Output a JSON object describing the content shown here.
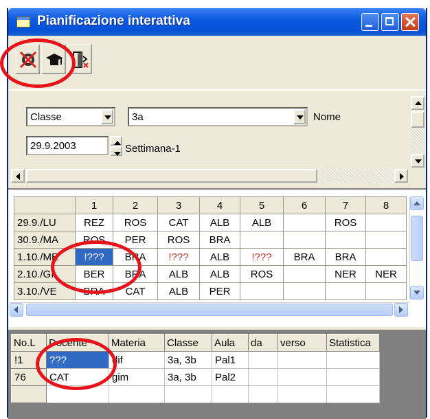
{
  "window": {
    "title": "Pianificazione interattiva"
  },
  "toolbar": {
    "tools": [
      "no-access-icon",
      "graduation-cap-icon",
      "exit-door-icon"
    ]
  },
  "filters": {
    "type_select": "Classe",
    "class_select": "3a",
    "name_label": "Nome",
    "date_value": "29.9.2003",
    "week_label": "Settimana-1"
  },
  "timetable": {
    "columns": [
      "1",
      "2",
      "3",
      "4",
      "5",
      "6",
      "7",
      "8"
    ],
    "rows": [
      {
        "label": "29.9./LU",
        "cells": [
          "REZ",
          "ROS",
          "CAT",
          "ALB",
          "ALB",
          "",
          "ROS",
          ""
        ]
      },
      {
        "label": "30.9./MA",
        "cells": [
          "ROS",
          "PER",
          "ROS",
          "BRA",
          "",
          "",
          "",
          ""
        ]
      },
      {
        "label": "1.10./ME",
        "cells": [
          "!???",
          "BRA",
          "!???",
          "ALB",
          "!???",
          "BRA",
          "BRA",
          ""
        ]
      },
      {
        "label": "2.10./GI",
        "cells": [
          "BER",
          "BRA",
          "ALB",
          "ALB",
          "ROS",
          "",
          "NER",
          "NER"
        ]
      },
      {
        "label": "3.10./VE",
        "cells": [
          "BRA",
          "CAT",
          "ALB",
          "PER",
          "",
          "",
          "",
          ""
        ]
      }
    ],
    "selected_cell": "1.10./ME:1",
    "warning_color": "#c0392b",
    "selection_color": "#316ac5"
  },
  "lessons": {
    "columns": [
      "No.L",
      "Docente",
      "Materia",
      "Classe",
      "Aula",
      "da",
      "verso",
      "Statistica"
    ],
    "rows": [
      {
        "cells": [
          "!1",
          "???",
          "dif",
          "3a, 3b",
          "Pal1",
          "",
          "",
          ""
        ]
      },
      {
        "cells": [
          "76",
          "CAT",
          "gim",
          "3a, 3b",
          "Pal2",
          "",
          "",
          ""
        ]
      },
      {
        "cells": [
          "",
          "",
          "",
          "",
          "",
          "",
          "",
          ""
        ]
      }
    ]
  },
  "annotation_color": "#e8131a"
}
